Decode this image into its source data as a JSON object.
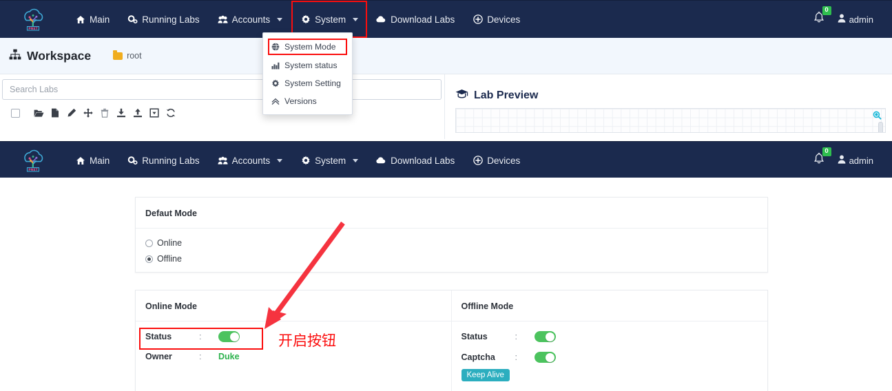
{
  "brand": {
    "name": "PNET",
    "colors": {
      "navbar_bg": "#1b2a4e",
      "accent_red": "#fb0d0d",
      "toggle_green": "#4cc35e",
      "badge_green": "#2fbf4f",
      "keepalive_teal": "#2caebf",
      "owner_green": "#2bb24c",
      "zoom_cyan": "#18b8d8"
    }
  },
  "navbar": {
    "items": [
      {
        "label": "Main",
        "icon": "home-icon",
        "caret": false
      },
      {
        "label": "Running Labs",
        "icon": "cogs-icon",
        "caret": false
      },
      {
        "label": "Accounts",
        "icon": "users-icon",
        "caret": true
      },
      {
        "label": "System",
        "icon": "gear-icon",
        "caret": true
      },
      {
        "label": "Download Labs",
        "icon": "cloud-icon",
        "caret": false
      },
      {
        "label": "Devices",
        "icon": "plus-circle-icon",
        "caret": false
      }
    ],
    "notifications": {
      "icon": "bell-icon",
      "count": "0"
    },
    "user": {
      "label": "admin",
      "icon": "user-icon",
      "caret": true
    }
  },
  "system_dropdown": {
    "items": [
      {
        "label": "System Mode",
        "icon": "globe-icon",
        "selected": true
      },
      {
        "label": "System status",
        "icon": "chart-bar-icon",
        "selected": false
      },
      {
        "label": "System Setting",
        "icon": "gear-icon",
        "selected": false
      },
      {
        "label": "Versions",
        "icon": "chevron-up-icon",
        "selected": false
      }
    ]
  },
  "workspace": {
    "title": "Workspace",
    "title_icon": "sitemap-icon",
    "breadcrumb": "root",
    "breadcrumb_icon": "folder-icon"
  },
  "search": {
    "placeholder": "Search Labs",
    "value": ""
  },
  "toolbar": {
    "items": [
      {
        "name": "select-all-checkbox",
        "icon": "checkbox-icon"
      },
      {
        "name": "open-folder-button",
        "icon": "folder-open-icon"
      },
      {
        "name": "new-file-button",
        "icon": "file-icon"
      },
      {
        "name": "edit-button",
        "icon": "pencil-icon"
      },
      {
        "name": "move-button",
        "icon": "move-arrows-icon"
      },
      {
        "name": "delete-button",
        "icon": "trash-icon"
      },
      {
        "name": "import-button",
        "icon": "download-icon"
      },
      {
        "name": "export-button",
        "icon": "upload-icon"
      },
      {
        "name": "export-box-button",
        "icon": "box-export-icon"
      },
      {
        "name": "refresh-button",
        "icon": "refresh-icon"
      }
    ]
  },
  "lab_preview": {
    "title": "Lab Preview",
    "title_icon": "graduation-cap-icon",
    "zoom_icon": "magnifier-icon"
  },
  "default_mode_panel": {
    "title": "Defaut Mode",
    "options": [
      {
        "label": "Online",
        "selected": false
      },
      {
        "label": "Offline",
        "selected": true
      }
    ]
  },
  "online_mode_panel": {
    "title": "Online Mode",
    "rows": [
      {
        "key": "Status",
        "colon": ":",
        "type": "toggle",
        "value": "on"
      },
      {
        "key": "Owner",
        "colon": ":",
        "type": "text",
        "value": "Duke"
      }
    ]
  },
  "offline_mode_panel": {
    "title": "Offline Mode",
    "rows": [
      {
        "key": "Status",
        "colon": ":",
        "type": "toggle",
        "value": "on"
      },
      {
        "key": "Captcha",
        "colon": ":",
        "type": "toggle",
        "value": "on"
      }
    ],
    "keep_alive_label": "Keep Alive"
  },
  "annotations": {
    "callout_text": "开启按钮",
    "highlight_targets": [
      "System nav item",
      "System Mode menu item",
      "Online Mode Status toggle"
    ]
  }
}
